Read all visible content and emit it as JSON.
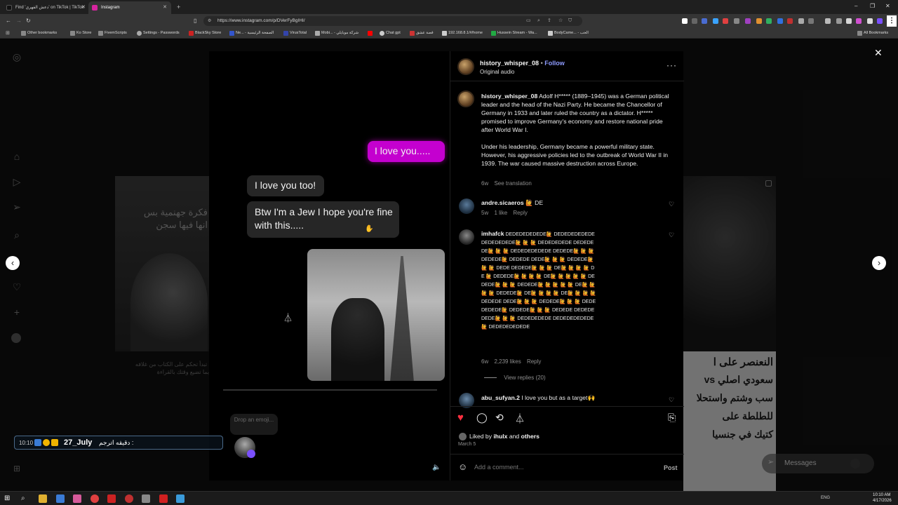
{
  "browser": {
    "tabs": [
      {
        "title": "Find 'دعش الفهري' on TikTok | TikTok",
        "active": false,
        "color": "#111111"
      },
      {
        "title": "Instagram",
        "active": true,
        "color": "#d6249f"
      }
    ],
    "url": "https://www.instagram.com/p/DVerFyBgIHI/",
    "bookmarks": [
      {
        "label": "Other bookmarks",
        "color": "#888888"
      },
      {
        "label": "Ko Store",
        "color": "#888888"
      },
      {
        "label": "FivemScripts",
        "color": "#888888"
      },
      {
        "label": "Settings - Passwords",
        "color": "#aaaaaa"
      },
      {
        "label": "BlackSky Store",
        "color": "#cc2222"
      },
      {
        "label": "Ne... - الصفحة الرئيسية",
        "color": "#3355cc"
      },
      {
        "label": "VirusTotal",
        "color": "#3344aa"
      },
      {
        "label": "Mobi... - شركة موبايلي",
        "color": "#aaaaaa"
      },
      {
        "label": "",
        "color": "#ff0000"
      },
      {
        "label": "Chat gpt",
        "color": "#cccccc"
      },
      {
        "label": "قصة عشق",
        "color": "#cc3333"
      },
      {
        "label": "192.168.8.1/#/home",
        "color": "#cccccc"
      },
      {
        "label": "Hussein Stream - Wa...",
        "color": "#22aa44"
      },
      {
        "label": "BodyCame... - الحب",
        "color": "#cccccc"
      }
    ],
    "all_bookmarks": "All Bookmarks"
  },
  "post": {
    "chat": {
      "sent": "I love you.....",
      "reply1": "I love you too!",
      "reply2": "Btw I'm a Jew I hope you're fine with this....."
    },
    "author": "history_whisper_08",
    "dot": "•",
    "follow": "Follow",
    "audio": "Original audio",
    "caption_p1": "Adolf H***** (1889–1945) was a German political leader and the head of the Nazi Party. He became the Chancellor of Germany in 1933 and later ruled the country as a dictator. H***** promised to improve Germany's economy and restore national pride after World War I.",
    "caption_p2": "Under his leadership, Germany became a powerful military state. However, his aggressive policies led to the outbreak of World War II in 1939. The war caused massive destruction across Europe.",
    "caption_age": "6w",
    "see_translation": "See translation",
    "comments": [
      {
        "user": "andre.sicaeros",
        "text": "🙋 DE",
        "age": "5w",
        "likes": "1 like",
        "reply": "Reply"
      },
      {
        "user": "imhafck",
        "text": "DEDEDEDEDEDE🙋 DEDEDEDEDEDE DEDEDEDEDE🙋 🙋 🙋 DEDEDEDEDE DEDEDEDE🙋 🙋 🙋 DEDEDEDEDEDE DEDEDE🙋 🙋 🙋 DEDEDE🙋 DEDEDE DEDE🙋 🙋 🙋 DEDEDE🙋 🙋 🙋 DEDE DEDEDE🙋 🙋 🙋 DE🙋 🙋 🙋 🙋 DE 🙋 DEDEDE🙋 🙋 🙋 🙋 DE🙋 🙋 🙋 🙋 🙋 DEDEDE🙋 🙋 🙋 DEDEDE🙋 🙋 🙋 🙋 🙋 DE🙋 🙋 🙋 🙋 DEDEDE🙋 DE🙋 🙋 🙋 🙋 DE🙋 🙋 🙋 🙋 DEDEDE DEDE🙋 🙋 🙋 DEDEDE🙋 🙋 🙋 DEDE DEDEDE🙋 DEDEDE🙋 🙋 🙋 DEDEDE DEDEDEDEDE🙋 🙋 🙋 DEDEDEDEDE DEDEDEDEDEDE🙋 DEDEDEDEDEDE",
        "age": "6w",
        "likes": "2,239 likes",
        "reply": "Reply"
      },
      {
        "user": "abu_sufyan.2",
        "text": "I love you but as a target🙌"
      }
    ],
    "view_replies": "View replies (20)",
    "liked_by_prefix": "Liked by",
    "liked_by_user": "ihulx",
    "liked_by_and": "and",
    "liked_by_others": "others",
    "date": "March 5",
    "comment_placeholder": "Add a comment...",
    "post_btn": "Post"
  },
  "overlay": {
    "drop_emoji": "Drop an emoji...",
    "stream_time": "10:10",
    "stream_name": "27_July",
    "stream_text": ": دقيقه اترجم"
  },
  "background": {
    "left_arabic_1": "فكرة جهنمية بس",
    "left_arabic_2": "انها فيها سجن",
    "left_caption_1": "لا تبدأ تحكم على الكتاب من غلافه",
    "left_caption_2": "ربما تضيع وقتك بالقراءة",
    "right_arabic_1": "النعنصر على ا",
    "right_arabic_2": "سعودي اصلي vs",
    "right_arabic_3": "سب وشتم واستحلا",
    "right_arabic_4": "للطلطة على",
    "right_arabic_5": "كتيك في جنسيا"
  },
  "messages": {
    "label": "Messages"
  },
  "system": {
    "time": "10:10 AM",
    "date": "4/17/2026",
    "lang": "ENG"
  },
  "colors": {
    "accent": "#d300d3",
    "follow": "#8e9bff",
    "like": "#ff3040"
  }
}
